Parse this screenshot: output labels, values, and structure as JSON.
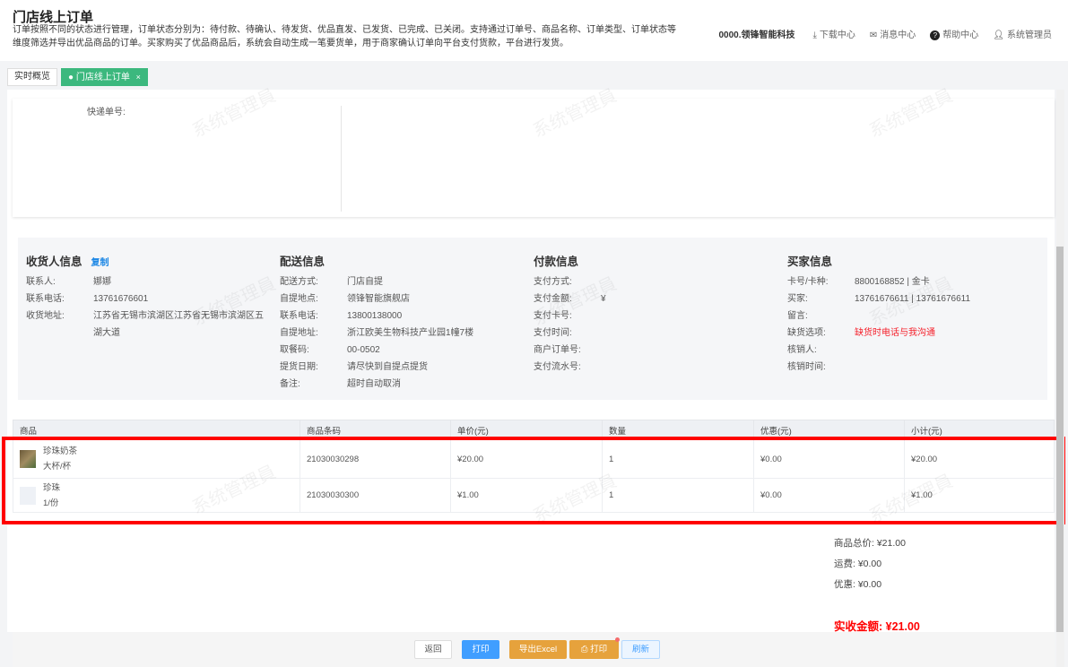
{
  "header": {
    "title": "门店线上订单",
    "description": "订单按照不同的状态进行管理，订单状态分别为：待付款、待确认、待发货、优品直发、已发货、已完成、已关闭。支持通过订单号、商品名称、订单类型、订单状态等维度筛选并导出优品商品的订单。买家购买了优品商品后，系统会自动生成一笔要货单，用于商家确认订单向平台支付货款，平台进行发货。",
    "org": "0000.领锋智能科技",
    "download": "下载中心",
    "messages": "消息中心",
    "help": "帮助中心",
    "user": "系统管理员"
  },
  "tabs": [
    {
      "label": "实时概览"
    },
    {
      "label": "门店线上订单",
      "close": "×"
    }
  ],
  "watermark": "系统管理員",
  "express": {
    "label": "快递单号:"
  },
  "receiver": {
    "title": "收货人信息",
    "copy": "复制",
    "rows": [
      {
        "k": "联系人:",
        "v": "娜娜"
      },
      {
        "k": "联系电话:",
        "v": "13761676601"
      },
      {
        "k": "收货地址:",
        "v": "江苏省无锡市滨湖区江苏省无锡市滨湖区五湖大道"
      }
    ]
  },
  "delivery": {
    "title": "配送信息",
    "rows": [
      {
        "k": "配送方式:",
        "v": "门店自提"
      },
      {
        "k": "自提地点:",
        "v": "领锋智能旗舰店"
      },
      {
        "k": "联系电话:",
        "v": "13800138000"
      },
      {
        "k": "自提地址:",
        "v": "浙江欧美生物科技产业园1幢7楼"
      },
      {
        "k": "取餐码:",
        "v": "00-0502"
      },
      {
        "k": "提货日期:",
        "v": "请尽快到自提点提货"
      },
      {
        "k": "备注:",
        "v": "超时自动取消"
      }
    ]
  },
  "payment": {
    "title": "付款信息",
    "rows": [
      {
        "k": "支付方式:",
        "v": ""
      },
      {
        "k": "支付金额:",
        "v": "¥"
      },
      {
        "k": "支付卡号:",
        "v": ""
      },
      {
        "k": "支付时间:",
        "v": ""
      },
      {
        "k": "商户订单号:",
        "v": ""
      },
      {
        "k": "支付流水号:",
        "v": ""
      }
    ]
  },
  "buyer": {
    "title": "买家信息",
    "rows": [
      {
        "k": "卡号/卡种:",
        "v": "8800168852 | 金卡"
      },
      {
        "k": "买家:",
        "v": "13761676611 | 13761676611"
      },
      {
        "k": "留言:",
        "v": ""
      },
      {
        "k": "缺货选项:",
        "v": "缺货时电话与我沟通"
      },
      {
        "k": "核销人:",
        "v": ""
      },
      {
        "k": "核销时间:",
        "v": ""
      }
    ]
  },
  "table": {
    "headers": [
      "商品",
      "商品条码",
      "单价(元)",
      "数量",
      "优惠(元)",
      "小计(元)"
    ],
    "rows": [
      {
        "name": "珍珠奶茶",
        "spec": "大杯/杯",
        "barcode": "21030030298",
        "price": "¥20.00",
        "qty": "1",
        "discount": "¥0.00",
        "subtotal": "¥20.00"
      },
      {
        "name": "珍珠",
        "spec": "1/份",
        "barcode": "21030030300",
        "price": "¥1.00",
        "qty": "1",
        "discount": "¥0.00",
        "subtotal": "¥1.00"
      }
    ]
  },
  "summary": {
    "goods_total": "商品总价: ¥21.00",
    "shipping": "运费: ¥0.00",
    "discount": "优惠: ¥0.00",
    "received": "实收金额: ¥21.00"
  },
  "buttons": {
    "back": "返回",
    "print": "打印",
    "export": "导出Excel",
    "print2": "打印",
    "refresh": "刷新"
  },
  "colors": {
    "accent": "#3cb87e",
    "danger": "#f5222d",
    "primary": "#409eff",
    "warning": "#e6a23c"
  }
}
